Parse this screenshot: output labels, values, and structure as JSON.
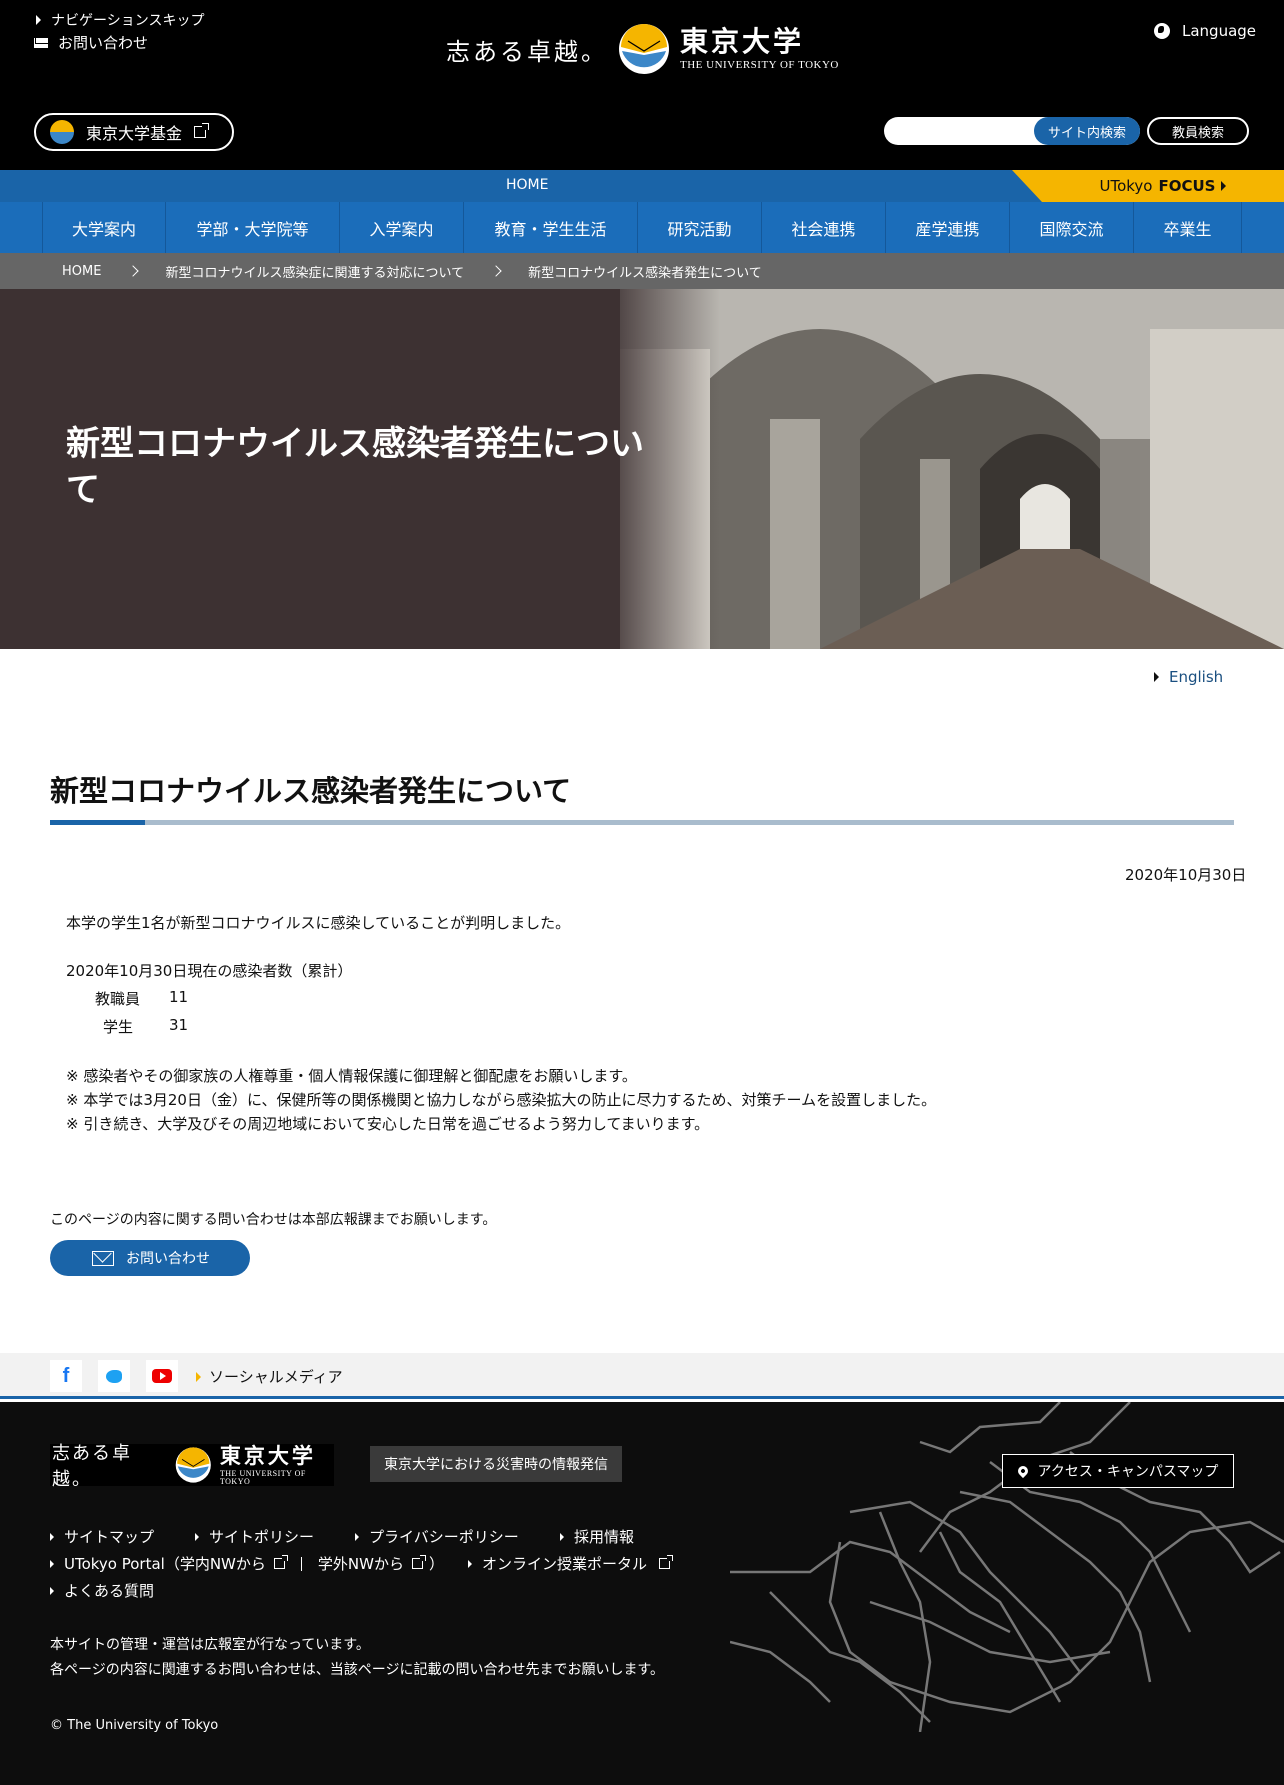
{
  "header": {
    "skip_nav": "ナビゲーションスキップ",
    "contact": "お問い合わせ",
    "slogan": "志ある卓越。",
    "logo_jp": "東京大学",
    "logo_en": "THE UNIVERSITY OF TOKYO",
    "language": "Language",
    "fund": "東京大学基金",
    "search_placeholder": "",
    "site_search": "サイト内検索",
    "faculty_search": "教員検索"
  },
  "topbar": {
    "home": "HOME",
    "focus_prefix": "UTokyo",
    "focus_bold": "FOCUS"
  },
  "nav": [
    "大学案内",
    "学部・大学院等",
    "入学案内",
    "教育・学生生活",
    "研究活動",
    "社会連携",
    "産学連携",
    "国際交流",
    "卒業生"
  ],
  "breadcrumb": [
    "HOME",
    "新型コロナウイルス感染症に関連する対応について",
    "新型コロナウイルス感染者発生について"
  ],
  "hero": {
    "title": "新型コロナウイルス感染者発生について"
  },
  "content": {
    "english": "English",
    "title": "新型コロナウイルス感染者発生について",
    "date": "2020年10月30日",
    "intro": "本学の学生1名が新型コロナウイルスに感染していることが判明しました。",
    "count_heading": "2020年10月30日現在の感染者数（累計）",
    "counts": [
      {
        "label": "教職員",
        "value": "11"
      },
      {
        "label": "学生",
        "value": "31"
      }
    ],
    "notes": [
      "※ 感染者やその御家族の人権尊重・個人情報保護に御理解と御配慮をお願いします。",
      "※ 本学では3月20日（金）に、保健所等の関係機関と協力しながら感染拡大の防止に尽力するため、対策チームを設置しました。",
      "※ 引き続き、大学及びその周辺地域において安心した日常を過ごせるよう努力してまいります。"
    ],
    "contact_note": "このページの内容に関する問い合わせは本部広報課までお願いします。",
    "contact_button": "お問い合わせ"
  },
  "social": {
    "facebook": "f",
    "label": "ソーシャルメディア"
  },
  "footer": {
    "disaster_info": "東京大学における災害時の情報発信",
    "campus_map": "アクセス・キャンパスマップ",
    "links_row1": [
      "サイトマップ",
      "サイトポリシー",
      "プライバシーポリシー",
      "採用情報"
    ],
    "portal_prefix": "UTokyo Portal（学内NWから",
    "portal_outside": "学外NWから",
    "portal_suffix": "）",
    "online_portal": "オンライン授業ポータル",
    "faq": "よくある質問",
    "note1": "本サイトの管理・運営は広報室が行なっています。",
    "note2": "各ページの内容に関連するお問い合わせは、当該ページに記載の問い合わせ先までお願いします。",
    "copyright": "© The University of Tokyo"
  },
  "colors": {
    "brand_blue": "#1a64a8",
    "accent_yellow": "#f5b500",
    "hero_bg": "#3d3132"
  }
}
